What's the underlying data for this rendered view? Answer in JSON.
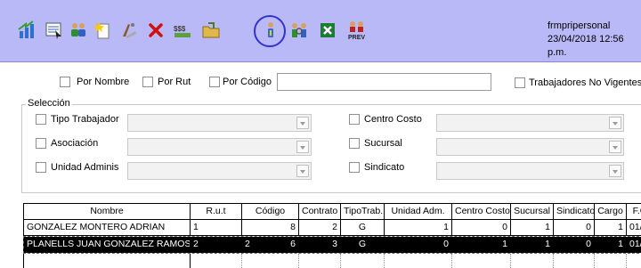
{
  "window": {
    "form_name": "frmpripersonal",
    "datetime": "23/04/2018 12:56 p.m."
  },
  "toolbar": {
    "icons": [
      "chart-arrow-icon",
      "list-select-icon",
      "users-group-icon",
      "new-document-icon",
      "clear-icon",
      "delete-icon",
      "money-icon",
      "folder-open-icon",
      "person-info-icon",
      "people-search-icon",
      "excel-icon",
      "preview-icon"
    ],
    "prev_label": "PREV"
  },
  "filters": {
    "por_nombre": "Por Nombre",
    "por_rut": "Por Rut",
    "por_codigo": "Por Código",
    "search_value": "",
    "no_vigentes": "Trabajadores No Vigentes"
  },
  "seleccion": {
    "legend": "Selección",
    "tipo_trabajador": "Tipo Trabajador",
    "asociacion": "Asociación",
    "unidad_adminis": "Unidad Adminis",
    "centro_costo": "Centro Costo",
    "sucursal": "Sucursal",
    "sindicato": "Sindicato"
  },
  "grid": {
    "columns": [
      "Nombre",
      "R.u.t",
      "Código",
      "Contrato",
      "TipoTrab.",
      "Unidad Adm.",
      "Centro Costo",
      "Sucursal",
      "Sindicato",
      "Cargo",
      "F.C"
    ],
    "rows": [
      [
        "GONZALEZ MONTERO ADRIAN",
        "1",
        "8",
        "2",
        "G",
        "1",
        "0",
        "1",
        "0",
        "1",
        "01/"
      ],
      [
        "PLANELLS JUAN GONZALEZ RAMOS L",
        "2",
        "6",
        "3",
        "G",
        "0",
        "1",
        "1",
        "0",
        "1",
        "01/"
      ]
    ],
    "row1_rut_extra": "",
    "row2_codigo_extra": "2"
  },
  "colors": {
    "toolbar_bg": "#b9b9f7",
    "highlight_circle": "#3333cc",
    "selected_row_bg": "#000000",
    "selected_row_fg": "#ffffff"
  }
}
